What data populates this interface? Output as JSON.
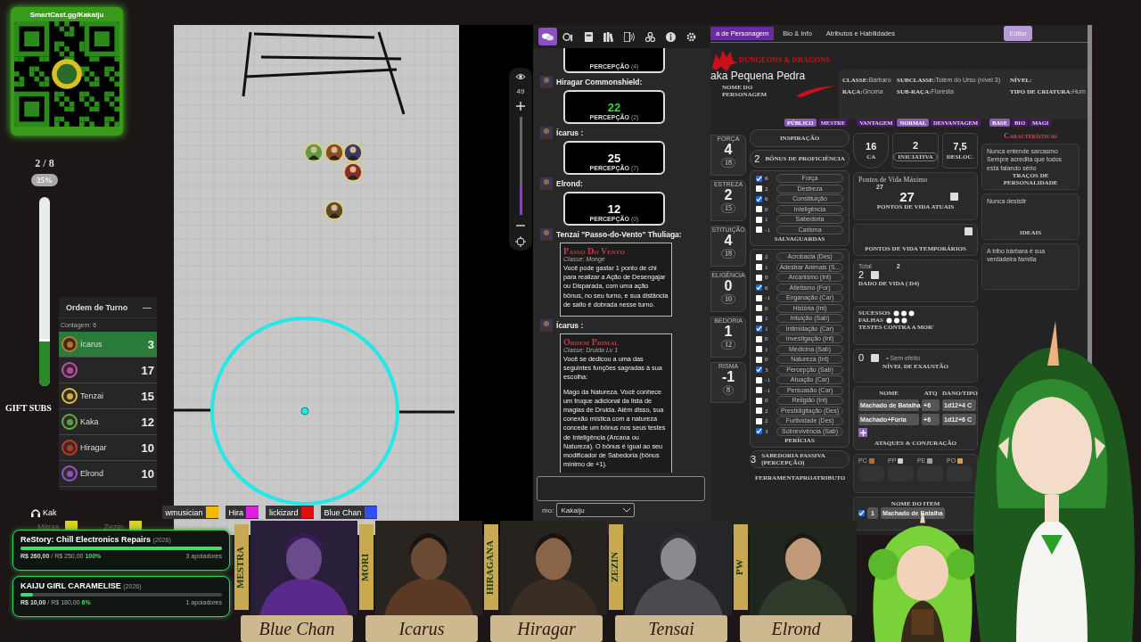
{
  "qr_panel": {
    "url": "SmartCast.gg/Kakaiju"
  },
  "zoom_meter": {
    "pages": "2 / 8",
    "percent": "25%",
    "level": 0.25
  },
  "gift_subs": "GIFT SUBS",
  "turn_order": {
    "title": "Ordem de Turno",
    "collapse": "—",
    "count": "Contagem: 6",
    "entries": [
      {
        "name": "Ícarus",
        "initiative": "3",
        "selected": true,
        "color": "#c07a2a"
      },
      {
        "initiative": "17",
        "selected": false,
        "color": "#c04fc0"
      },
      {
        "name": "Tenzai",
        "initiative": "15",
        "selected": false,
        "color": "#d8c050"
      },
      {
        "name": "Kaka",
        "initiative": "12",
        "selected": false,
        "color": "#5ab04a"
      },
      {
        "name": "Hiragar",
        "initiative": "10",
        "selected": false,
        "color": "#c0392b"
      },
      {
        "name": "Elrond",
        "initiative": "10",
        "selected": false,
        "color": "#8a5ad0"
      }
    ]
  },
  "voice": {
    "listener": "Kak",
    "speakers": [
      {
        "name": "wmusician",
        "color": "#f5b800"
      },
      {
        "name": "Hira",
        "color": "#e020e0"
      },
      {
        "name": "lickizard",
        "color": "#e01010"
      },
      {
        "name": "Blue Chan",
        "color": "#3050f0"
      }
    ],
    "muted": [
      {
        "name": "Mitras",
        "color": "#d8d020"
      },
      {
        "name": "Zezin",
        "color": "#d8d020"
      }
    ]
  },
  "donation_goals": [
    {
      "title": "ReStory: Chill Electronics Repairs",
      "year": "(2026)",
      "raised": "R$ 260,00",
      "goal": "/ R$ 250,00",
      "percent": "100%",
      "supporters": "3 apoiadores",
      "level": 1
    },
    {
      "title": "KAIJU GIRL CARAMELISE",
      "year": "(2026)",
      "raised": "R$ 10,00",
      "goal": "/ R$ 180,00",
      "percent": "6%",
      "supporters": "1 apoiadores",
      "level": 0.06
    }
  ],
  "map_controls": {
    "zoom": "49",
    "level": 0.3
  },
  "chat": {
    "tabs": [
      {
        "selected": true
      },
      {
        "selected": false
      },
      {
        "selected": false
      },
      {
        "selected": false
      },
      {
        "selected": false
      },
      {
        "selected": false
      },
      {
        "selected": false
      },
      {
        "selected": false
      }
    ],
    "messages": [
      {
        "kind": "roll",
        "label": "PERCEPÇÃO",
        "modifier": "(4)"
      },
      {
        "kind": "roll",
        "speaker": "Hiragar Commonshield:",
        "result": "22",
        "critical": true,
        "label": "PERCEPÇÃO",
        "modifier": "(2)"
      },
      {
        "kind": "roll",
        "speaker": "Ícarus :",
        "result": "25",
        "critical": false,
        "label": "PERCEPÇÃO",
        "modifier": "(7)"
      },
      {
        "kind": "roll",
        "speaker": "Elrond:",
        "result": "12",
        "critical": false,
        "label": "PERCEPÇÃO",
        "modifier": "(0)"
      },
      {
        "kind": "card",
        "speaker": "Tenzai \"Passo-do-Vento\" Thuliaga:",
        "title": "Passo Do Vento",
        "subtitle": "Classe: Monge",
        "body": [
          "Você pode gastar 1 ponto de chi para realizar a Ação de Desengajar ou Disparada, com uma ação bônus, no seu turno, e sua distância de salto é dobrada nesse turno."
        ]
      },
      {
        "kind": "card",
        "speaker": "Ícarus :",
        "title": "Ordem Primal",
        "subtitle": "Classe: Druida Lv 1",
        "body": [
          "Você se dedicou a uma das seguintes funções sagradas à sua escolha:",
          "Mago da Natureza. Você conhece um truque adicional da lista de magias de Druida. Além disso, sua conexão mística com a natureza concede um bônus nos seus testes de Inteligência (Arcana ou Natureza). O bônus é igual ao seu modificador de Sabedoria (bônus mínimo de +1)."
        ]
      }
    ],
    "speaking_as": {
      "label": "mo:",
      "value": "Kakaiju"
    }
  },
  "sheet": {
    "tabs": [
      {
        "label": "a de Personagem",
        "selected": true
      },
      {
        "label": "Bio & Info",
        "selected": false
      },
      {
        "label": "Atributos e Habilidades",
        "selected": false
      }
    ],
    "edit_button": "Editar",
    "logo": "DUNGEONS & DRAGONS",
    "character_name": "aka Pequena Pedra",
    "character_name_caption": "NOME DO PERSONAGEM",
    "info": [
      {
        "label": "CLASSE:",
        "value": "Bárbaro"
      },
      {
        "label": "SUBCLASSE:",
        "value": "Totem do Urso (nível 3)"
      },
      {
        "label": "NÍVEL:"
      },
      {
        "label": "RAÇA:",
        "value": "Gnoma"
      },
      {
        "label": "SUB-RAÇA:",
        "value": "Floresta"
      },
      {
        "label": "TIPO DE CRIATURA:",
        "value": "Hum"
      }
    ],
    "toggles": [
      {
        "label": "PÚBLICO",
        "selected": true
      },
      {
        "label": "MESTRE",
        "selected": false
      },
      {
        "label": "VANTAGEM",
        "selected": false
      },
      {
        "label": "NORMAL",
        "selected": true
      },
      {
        "label": "DESVANTAGEM",
        "selected": false
      },
      {
        "label": "BASE",
        "selected": true
      },
      {
        "label": "BIO",
        "selected": false
      },
      {
        "label": "MAGI",
        "selected": false
      }
    ],
    "abilities": [
      {
        "label": "FORÇA",
        "modifier": "4",
        "score": "18"
      },
      {
        "label": "ESTREZA",
        "modifier": "2",
        "score": "15"
      },
      {
        "label": "STITUIÇÃO",
        "modifier": "4",
        "score": "18"
      },
      {
        "label": "ELIGÊNCIA",
        "modifier": "0",
        "score": "10"
      },
      {
        "label": "BEDORIA",
        "modifier": "1",
        "score": "12"
      },
      {
        "label": "RISMA",
        "modifier": "-1",
        "score": "8"
      }
    ],
    "inspiration": "INSPIRAÇÃO",
    "proficiency": {
      "value": "2",
      "label": "BÔNUS DE PROFICIÊNCIA"
    },
    "saving_throws_title": "SALVAGUARDAS",
    "saving_throws": [
      {
        "label": "Força",
        "value": "6",
        "checked": true
      },
      {
        "label": "Destreza",
        "value": "2",
        "checked": false
      },
      {
        "label": "Constituição",
        "value": "6",
        "checked": true
      },
      {
        "label": "Inteligência",
        "value": "0",
        "checked": false
      },
      {
        "label": "Sabedoria",
        "value": "1",
        "checked": false
      },
      {
        "label": "Carisma",
        "value": "-1",
        "checked": false
      }
    ],
    "skills_title": "PERÍCIAS",
    "skills": [
      {
        "label": "Acrobacia (Des)",
        "value": "2",
        "checked": false
      },
      {
        "label": "Adestrar Animais (S...",
        "value": "1",
        "checked": false
      },
      {
        "label": "Arcanismo (Int)",
        "value": "0",
        "checked": false
      },
      {
        "label": "Atletismo (For)",
        "value": "6",
        "checked": true
      },
      {
        "label": "Enganação (Car)",
        "value": "-1",
        "checked": false
      },
      {
        "label": "História (Int)",
        "value": "0",
        "checked": false
      },
      {
        "label": "Intuição (Sab)",
        "value": "1",
        "checked": false
      },
      {
        "label": "Intimidação (Car)",
        "value": "1",
        "checked": true
      },
      {
        "label": "Investigação (Int)",
        "value": "0",
        "checked": false
      },
      {
        "label": "Medicina (Sab)",
        "value": "1",
        "checked": false
      },
      {
        "label": "Natureza (Int)",
        "value": "0",
        "checked": false
      },
      {
        "label": "Percepção (Sab)",
        "value": "3",
        "checked": true
      },
      {
        "label": "Atuação (Car)",
        "value": "-1",
        "checked": false
      },
      {
        "label": "Persuasão (Car)",
        "value": "-1",
        "checked": false
      },
      {
        "label": "Religião (Int)",
        "value": "0",
        "checked": false
      },
      {
        "label": "Prestidigitação (Des)",
        "value": "2",
        "checked": false
      },
      {
        "label": "Furtividade (Des)",
        "value": "2",
        "checked": false
      },
      {
        "label": "Sobrevivência (Sab)",
        "value": "3",
        "checked": true
      }
    ],
    "passive_wisdom": {
      "value": "3",
      "label": "SABEDORIA PASSIVA (PERCEPÇÃO)"
    },
    "tools_columns": [
      "FERRAMENTA",
      "PRO",
      "ATRIBUTO"
    ],
    "combat": [
      {
        "value": "16",
        "label": "CA"
      },
      {
        "value": "2",
        "label": "INICIATIVA"
      },
      {
        "value": "7,5",
        "label": "DESLOC."
      }
    ],
    "hp": {
      "max_label": "Pontos de Vida Máximo",
      "max": "27",
      "current": "27",
      "current_label": "PONTOS DE VIDA ATUAIS",
      "temp_label": "PONTOS DE VIDA TEMPORÁRIOS"
    },
    "hit_dice": {
      "total_label": "Total",
      "total": "2",
      "value": "2",
      "label": "DADO DE VIDA",
      "die": "( D4)"
    },
    "death_saves": {
      "successes_label": "SUCESSOS",
      "failures_label": "FALHAS",
      "label": "TESTES CONTRA A MOR'"
    },
    "exhaustion": {
      "value": "0",
      "note": "• Sem efeito",
      "label": "NÍVEL DE EXAUSTÃO"
    },
    "attacks": {
      "columns": [
        "NOME",
        "ATQ",
        "DANO/TIPO"
      ],
      "rows": [
        [
          "Machado de Batalha",
          "+6",
          "1d12+4 C"
        ],
        [
          "Machado+Fúria",
          "+6",
          "1d12+6 C"
        ]
      ],
      "title": "ATAQUES & CONJURAÇÃO"
    },
    "coins": [
      "PC",
      "PP",
      "PE",
      "PO"
    ],
    "inventory": {
      "column": "NOME DO ITEM",
      "rows": [
        {
          "checked": true,
          "quantity": "1",
          "name": "Machado de Batalha"
        }
      ]
    },
    "characteristics": {
      "title": "Características",
      "cards": [
        {
          "text": "Nunca entende sarcasmo Sempre acredita que todos está falando sério",
          "label": "TRAÇOS DE PERSONALIDADE"
        },
        {
          "text": "Nunca desistir",
          "label": "IDEAIS"
        },
        {
          "text": "A tribo bárbara é sua verdadeira família"
        }
      ]
    }
  },
  "party_banner": [
    {
      "role": "MESTRA",
      "name": "Blue Chan"
    },
    {
      "role": "MORI",
      "name": "Icarus"
    },
    {
      "role": "HIRAGANA",
      "name": "Hiragar"
    },
    {
      "role": "ZEZIN",
      "name": "Tensai"
    },
    {
      "role": "PW",
      "name": "Elrond"
    }
  ]
}
